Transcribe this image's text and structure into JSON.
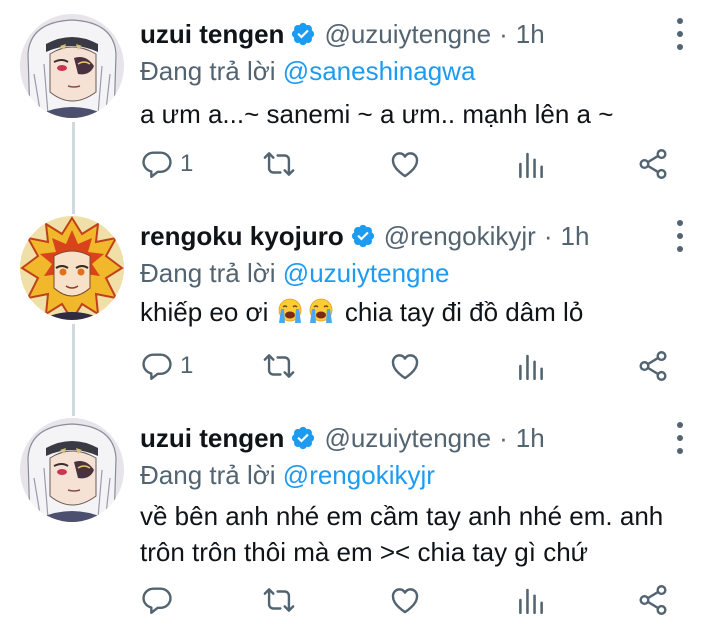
{
  "tweets": [
    {
      "name": "uzui tengen",
      "handle": "@uzuiytengne",
      "separator": "·",
      "time": "1h",
      "reply_prefix": "Đang trả lời",
      "reply_to": "@saneshinagwa",
      "text": "a ưm a...~ sanemi ~ a ưm.. mạnh lên a ~",
      "reply_count": "1",
      "avatar": "uzui-avatar"
    },
    {
      "name": "rengoku kyojuro",
      "handle": "@rengokikyjr",
      "separator": "·",
      "time": "1h",
      "reply_prefix": "Đang trả lời",
      "reply_to": "@uzuiytengne",
      "text_before": "khiếp eo ơi",
      "emojis": [
        "loudly-crying-face",
        "loudly-crying-face"
      ],
      "text_after": "chia tay đi đồ dâm lỏ",
      "reply_count": "1",
      "avatar": "rengoku-avatar"
    },
    {
      "name": "uzui tengen",
      "handle": "@uzuiytengne",
      "separator": "·",
      "time": "1h",
      "reply_prefix": "Đang trả lời",
      "reply_to": "@rengokikyjr",
      "text_line1": "về bên anh nhé em cầm tay anh nhé em. anh",
      "text_line2": "trôn trôn thôi mà em >< chia tay gì chứ",
      "reply_count": "",
      "avatar": "uzui-avatar"
    }
  ],
  "colors": {
    "accent": "#1d9bf0",
    "secondary_text": "#536471",
    "primary_text": "#0f1419",
    "thread_line": "#cfd9de"
  },
  "icons": [
    "reply-icon",
    "retweet-icon",
    "like-icon",
    "analytics-icon",
    "share-icon",
    "verified-badge-icon",
    "more-options-icon"
  ]
}
